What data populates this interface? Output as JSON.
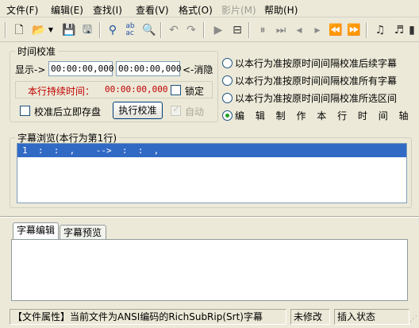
{
  "menu": [
    "文件(F)",
    "编辑(E)",
    "查找(I)",
    "查看(V)",
    "格式(O)",
    "影片(M)",
    "帮助(H)"
  ],
  "toolbar_icons": [
    "new-file-icon",
    "open-folder-icon",
    "dropdown-arrow-icon",
    "save-icon",
    "save-as-icon",
    "find-icon",
    "replace-icon",
    "preview-icon",
    "undo-icon",
    "redo-icon",
    "play-icon",
    "video-window-icon",
    "pause-icon",
    "step-forward-icon",
    "previous-icon",
    "next-icon",
    "rewind-icon",
    "fast-forward-icon",
    "sync-icon-1",
    "sync-icon-2",
    "more-icon"
  ],
  "timing": {
    "legend": "时间校准",
    "display_label": "显示->",
    "display_value": "00:00:00,000",
    "second_value": "00:00:00,000",
    "cancel_label": "<-消隐",
    "duration_label": "本行持续时间：",
    "duration_value": "00:00:00,000",
    "lock_label": "锁定",
    "save_after_label": "校准后立即存盘",
    "execute_label": "执行校准",
    "auto_label": "自动"
  },
  "options": [
    "以本行为准按原时间间隔校准后续字幕",
    "以本行为准按原时间间隔校准所有字幕",
    "以本行为准按原时间间隔校准所选区间",
    "编 辑 制 作 本 行 时 间 轴"
  ],
  "browser": {
    "legend": "字幕浏览(本行为第1行)",
    "row_number": "1",
    "row_text": "  :  :  ,    -->  :  :  ,"
  },
  "tabs": [
    "字幕编辑",
    "字幕预览"
  ],
  "status": {
    "file_info": "【文件属性】当前文件为ANSI编码的RichSubRip(Srt)字幕",
    "modified": "未修改",
    "mode": "插入状态"
  },
  "colors": {
    "window_bg": "#ece9d8",
    "duration_text": "#c00000",
    "selection": "#316ac5",
    "radio_dot": "#21a121"
  }
}
